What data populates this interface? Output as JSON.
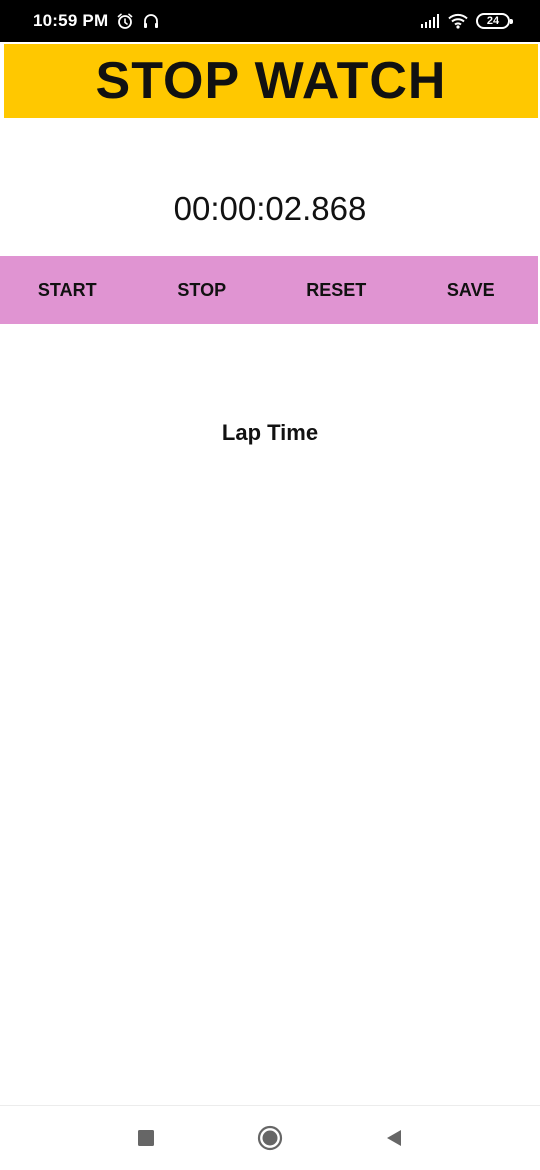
{
  "status_bar": {
    "time": "10:59 PM",
    "battery": "24",
    "icons": [
      "alarm-icon",
      "headphones-icon",
      "signal-icon",
      "wifi-icon",
      "battery-icon"
    ]
  },
  "header": {
    "title": "STOP WATCH",
    "background": "#FFC800"
  },
  "timer": {
    "display": "00:00:02.868"
  },
  "controls": {
    "background": "#E094D2",
    "start_label": "START",
    "stop_label": "STOP",
    "reset_label": "RESET",
    "save_label": "SAVE"
  },
  "laps": {
    "title": "Lap Time"
  },
  "nav_bar": {
    "icons": [
      "recent-apps-icon",
      "home-icon",
      "back-icon"
    ]
  }
}
